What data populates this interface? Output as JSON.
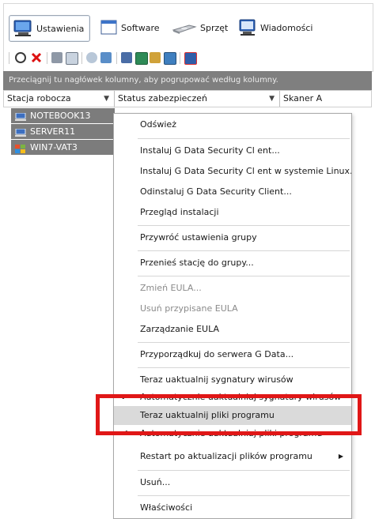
{
  "tabs": [
    {
      "label": "Ustawienia",
      "icon": "workstation-icon",
      "active": true
    },
    {
      "label": "Software",
      "icon": "window-icon",
      "active": false
    },
    {
      "label": "Sprzęt",
      "icon": "cd-drive-icon",
      "active": false
    },
    {
      "label": "Wiadomości",
      "icon": "message-icon",
      "active": false
    }
  ],
  "toolbar": {
    "icons": [
      "refresh-icon",
      "delete-icon",
      "print-icon",
      "print-preview-icon",
      "reload-icon",
      "shield-icon",
      "install-icon",
      "grid-icon",
      "tool-icon",
      "network-icon",
      "monitor-icon"
    ]
  },
  "groupbar": {
    "text": "Przeciągnij tu nagłówek kolumny, aby pogrupować według kolumny."
  },
  "columns": [
    {
      "label": "Stacja robocza"
    },
    {
      "label": "Status zabezpieczeń"
    },
    {
      "label": "Skaner A"
    }
  ],
  "stations": [
    {
      "name": "NOTEBOOK13",
      "icon": "notebook-icon"
    },
    {
      "name": "SERVER11",
      "icon": "server-icon"
    },
    {
      "name": "WIN7-VAT3",
      "icon": "windows-icon"
    }
  ],
  "menu": {
    "items": [
      {
        "label": "Odśwież"
      },
      {
        "label": "Instaluj G Data Security Cl ent..."
      },
      {
        "label": "Instaluj G Data Security Cl ent w systemie Linux..."
      },
      {
        "label": "Odinstaluj G Data Security Client..."
      },
      {
        "label": "Przegląd instalacji"
      },
      {
        "label": "Przywróć ustawienia grupy"
      },
      {
        "label": "Przenieś stację do grupy..."
      },
      {
        "label": "Zmień EULA...",
        "disabled": true
      },
      {
        "label": "Usuń przypisane EULA",
        "disabled": true
      },
      {
        "label": "Zarządzanie EULA"
      },
      {
        "label": "Przyporządkuj do serwera G Data..."
      },
      {
        "label": "Teraz uaktualnij sygnatury wirusów"
      },
      {
        "label": "Automatycznie uaktualniaj sygnatury wirusów",
        "checked": true
      },
      {
        "label": "Teraz uaktualnij pliki programu",
        "highlighted": true
      },
      {
        "label": "Automatycznie uaktualniaj pliki programu",
        "checked": true
      },
      {
        "label": "Restart po aktualizacji plików programu",
        "submenu": true
      },
      {
        "label": "Usuń..."
      },
      {
        "label": "Właściwości"
      }
    ],
    "check_glyph": "✔",
    "submenu_glyph": "▶"
  },
  "colors": {
    "annotation": "#e01717",
    "highlight": "#dadada",
    "station_bg": "#7c7c7c",
    "groupbar_bg": "#7f7f7f"
  }
}
